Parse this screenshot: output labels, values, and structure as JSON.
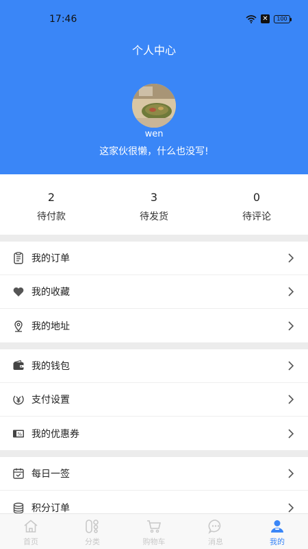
{
  "status_bar": {
    "time": "17:46",
    "battery": "100"
  },
  "header": {
    "title": "个人中心",
    "username": "wen",
    "bio": "这家伙很懒，什么也没写!"
  },
  "order_stats": [
    {
      "count": "2",
      "label": "待付款"
    },
    {
      "count": "3",
      "label": "待发货"
    },
    {
      "count": "0",
      "label": "待评论"
    }
  ],
  "menu_groups": [
    {
      "items": [
        {
          "label": "我的订单",
          "icon": "order-list-icon"
        },
        {
          "label": "我的收藏",
          "icon": "heart-icon"
        },
        {
          "label": "我的地址",
          "icon": "location-pin-icon"
        }
      ]
    },
    {
      "items": [
        {
          "label": "我的钱包",
          "icon": "wallet-icon"
        },
        {
          "label": "支付设置",
          "icon": "yuan-payment-icon"
        },
        {
          "label": "我的优惠券",
          "icon": "coupon-icon"
        }
      ]
    },
    {
      "items": [
        {
          "label": "每日一签",
          "icon": "calendar-check-icon"
        },
        {
          "label": "积分订单",
          "icon": "coins-icon"
        }
      ]
    }
  ],
  "tabbar": {
    "items": [
      {
        "label": "首页",
        "icon": "home-icon"
      },
      {
        "label": "分类",
        "icon": "category-icon"
      },
      {
        "label": "购物车",
        "icon": "cart-icon"
      },
      {
        "label": "消息",
        "icon": "message-icon"
      },
      {
        "label": "我的",
        "icon": "user-icon"
      }
    ],
    "active_index": 4
  },
  "colors": {
    "accent": "#3a86f7",
    "background": "#ececec",
    "inactive_tab": "#c8c8c8"
  }
}
